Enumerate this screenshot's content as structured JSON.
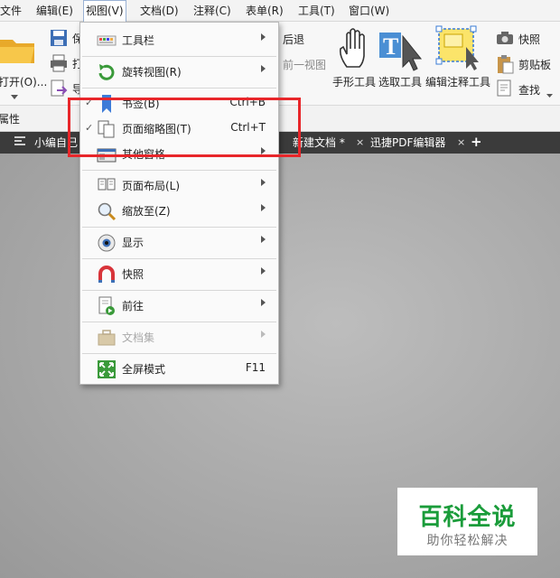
{
  "menubar": {
    "items": [
      "文件",
      "编辑(E)",
      "视图(V)",
      "文档(D)",
      "注释(C)",
      "表单(R)",
      "工具(T)",
      "窗口(W)"
    ]
  },
  "ribbon": {
    "open_label": "打开(O)...",
    "back_label": "后退",
    "prev_view_label": "前一视图",
    "hand_tool": "手形工具",
    "select_tool": "选取工具",
    "edit_annot_tool": "编辑注释工具",
    "snapshot": "快照",
    "clipboard": "剪贴板",
    "find": "查找",
    "partial_1": "保",
    "partial_2": "打",
    "partial_3": "导",
    "properties": "属性"
  },
  "tabs": {
    "tab1": "小编自己",
    "tab2": "新建文档 *",
    "tab3": "迅捷PDF编辑器",
    "close": "×",
    "add": "+"
  },
  "view_menu": {
    "items": [
      {
        "label": "工具栏",
        "shortcut": "",
        "submenu": true,
        "checked": false,
        "disabled": false,
        "icon": "toolbar-icon"
      },
      {
        "label": "旋转视图(R)",
        "shortcut": "",
        "submenu": true,
        "checked": false,
        "disabled": false,
        "icon": "rotate-view-icon"
      },
      {
        "label": "书签(B)",
        "shortcut": "Ctrl+B",
        "submenu": false,
        "checked": true,
        "disabled": false,
        "icon": "bookmark-icon"
      },
      {
        "label": "页面缩略图(T)",
        "shortcut": "Ctrl+T",
        "submenu": false,
        "checked": true,
        "disabled": false,
        "icon": "page-thumbnails-icon"
      },
      {
        "label": "其他窗格",
        "shortcut": "",
        "submenu": true,
        "checked": false,
        "disabled": false,
        "icon": "other-panes-icon"
      },
      {
        "label": "页面布局(L)",
        "shortcut": "",
        "submenu": true,
        "checked": false,
        "disabled": false,
        "icon": "page-layout-icon"
      },
      {
        "label": "缩放至(Z)",
        "shortcut": "",
        "submenu": true,
        "checked": false,
        "disabled": false,
        "icon": "zoom-icon"
      },
      {
        "label": "显示",
        "shortcut": "",
        "submenu": true,
        "checked": false,
        "disabled": false,
        "icon": "display-eye-icon"
      },
      {
        "label": "快照",
        "shortcut": "",
        "submenu": true,
        "checked": false,
        "disabled": false,
        "icon": "snapshot-magnet-icon"
      },
      {
        "label": "前往",
        "shortcut": "",
        "submenu": true,
        "checked": false,
        "disabled": false,
        "icon": "goto-page-icon"
      },
      {
        "label": "文档集",
        "shortcut": "",
        "submenu": true,
        "checked": false,
        "disabled": true,
        "icon": "portfolio-icon"
      },
      {
        "label": "全屏模式",
        "shortcut": "F11",
        "submenu": false,
        "checked": false,
        "disabled": false,
        "icon": "fullscreen-icon"
      }
    ],
    "check_glyph": "✓"
  },
  "watermark": {
    "title": "百科全说",
    "subtitle": "助你轻松解决"
  },
  "colors": {
    "highlight": "#e8262a",
    "watermark_green": "#1a9c3a",
    "tabstrip": "#3b3b3b"
  }
}
